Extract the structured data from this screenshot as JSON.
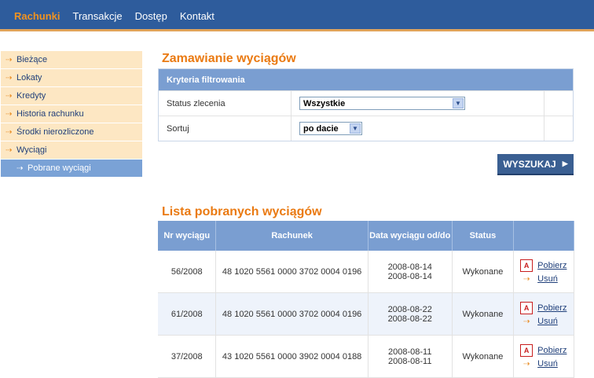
{
  "nav": {
    "items": [
      {
        "label": "Rachunki",
        "active": true
      },
      {
        "label": "Transakcje",
        "active": false
      },
      {
        "label": "Dostęp",
        "active": false
      },
      {
        "label": "Kontakt",
        "active": false
      }
    ]
  },
  "sidebar": {
    "items": [
      {
        "label": "Bieżące"
      },
      {
        "label": "Lokaty"
      },
      {
        "label": "Kredyty"
      },
      {
        "label": "Historia rachunku"
      },
      {
        "label": "Środki nierozliczone"
      },
      {
        "label": "Wyciągi"
      }
    ],
    "subitem": {
      "label": "Pobrane wyciągi"
    }
  },
  "order": {
    "title": "Zamawianie wyciągów",
    "filter_header": "Kryteria filtrowania",
    "status_label": "Status zlecenia",
    "status_value": "Wszystkie",
    "sort_label": "Sortuj",
    "sort_value": "po dacie",
    "search_button": "WYSZUKAJ"
  },
  "list": {
    "title": "Lista pobranych wyciągów",
    "columns": [
      "Nr wyciągu",
      "Rachunek",
      "Data wyciągu od/do",
      "Status",
      ""
    ],
    "rows": [
      {
        "nr": "56/2008",
        "account": "48 1020 5561 0000 3702 0004 0196",
        "date_from": "2008-08-14",
        "date_to": "2008-08-14",
        "status": "Wykonane"
      },
      {
        "nr": "61/2008",
        "account": "48 1020 5561 0000 3702 0004 0196",
        "date_from": "2008-08-22",
        "date_to": "2008-08-22",
        "status": "Wykonane"
      },
      {
        "nr": "37/2008",
        "account": "43 1020 5561 0000 3902 0004 0188",
        "date_from": "2008-08-11",
        "date_to": "2008-08-11",
        "status": "Wykonane"
      }
    ],
    "download_label": "Pobierz",
    "delete_label": "Usuń"
  },
  "colors": {
    "header_blue": "#2e5c9c",
    "accent_orange": "#ea7a12",
    "sidebar_bg": "#fde7c3",
    "table_header": "#7a9ed1"
  }
}
